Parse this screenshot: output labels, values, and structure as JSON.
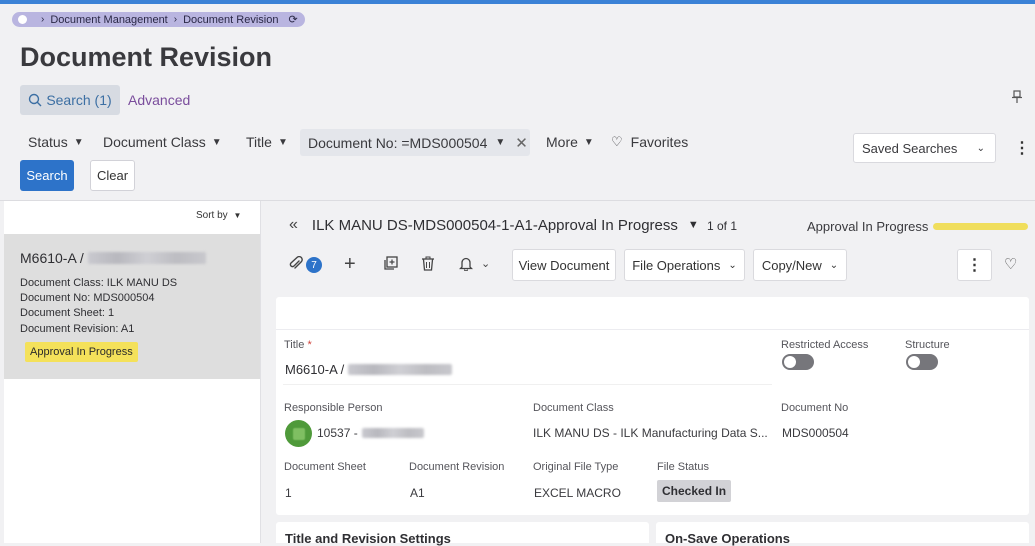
{
  "breadcrumb": {
    "items": [
      "Document Management",
      "Document Revision"
    ]
  },
  "page": {
    "title": "Document Revision"
  },
  "search_tabs": {
    "search": "Search (1)",
    "advanced": "Advanced"
  },
  "filters": {
    "status": "Status",
    "document_class": "Document Class",
    "title": "Title",
    "document_no_chip": "Document No: =MDS000504",
    "more": "More",
    "favorites": "Favorites",
    "saved_searches": "Saved Searches"
  },
  "buttons": {
    "search": "Search",
    "clear": "Clear"
  },
  "list": {
    "sort_by": "Sort by",
    "card": {
      "title_prefix": "M6610-A /",
      "lines": [
        "Document Class:   ILK MANU DS",
        "Document No:   MDS000504",
        "Document Sheet:   1",
        "Document Revision:   A1"
      ],
      "status": "Approval In Progress"
    }
  },
  "record": {
    "title": "ILK MANU DS-MDS000504-1-A1-Approval In Progress",
    "count": "1 of 1",
    "status": "Approval In Progress",
    "attachments_count": "7",
    "actions": {
      "view_document": "View Document",
      "file_operations": "File Operations",
      "copy_new": "Copy/New"
    }
  },
  "form": {
    "title_label": "Title",
    "title_value_prefix": "M6610-A /",
    "restricted_access_label": "Restricted Access",
    "structure_label": "Structure",
    "responsible_person_label": "Responsible Person",
    "responsible_person_value": "10537 -",
    "document_class_label": "Document Class",
    "document_class_value": "ILK MANU DS - ILK Manufacturing Data S...",
    "document_no_label": "Document No",
    "document_no_value": "MDS000504",
    "document_sheet_label": "Document Sheet",
    "document_sheet_value": "1",
    "document_revision_label": "Document Revision",
    "document_revision_value": "A1",
    "original_file_type_label": "Original File Type",
    "original_file_type_value": "EXCEL MACRO",
    "file_status_label": "File Status",
    "file_status_value": "Checked In"
  },
  "sections": {
    "title_revision": "Title and Revision Settings",
    "on_save": "On-Save Operations"
  },
  "icons": {
    "home": "home-icon",
    "refresh": "refresh-icon",
    "search": "search-icon",
    "pin": "pin-icon",
    "heart": "heart-icon",
    "kebab": "more-vertical-icon",
    "paperclip": "paperclip-icon",
    "plus": "plus-icon",
    "duplicate": "duplicate-icon",
    "trash": "trash-icon",
    "bell": "bell-icon"
  },
  "colors": {
    "accent": "#2d73c9",
    "status_yellow": "#f4e15a",
    "breadcrumb_bg": "#b9b5e0",
    "advanced_link": "#7a4d9c"
  }
}
